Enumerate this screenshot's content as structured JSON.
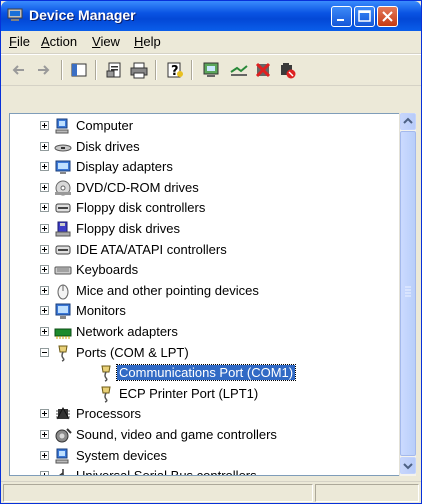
{
  "window": {
    "title": "Device Manager",
    "icon": "device-manager-icon"
  },
  "menubar": {
    "items": [
      {
        "label": "File",
        "accel": "F",
        "rest": "ile"
      },
      {
        "label": "Action",
        "accel": "A",
        "rest": "ction"
      },
      {
        "label": "View",
        "accel": "V",
        "rest": "iew"
      },
      {
        "label": "Help",
        "accel": "H",
        "rest": "elp"
      }
    ]
  },
  "toolbar": {
    "buttons": [
      "back-arrow-icon",
      "forward-arrow-icon",
      "show-hide-console-tree-icon",
      "properties-icon",
      "print-icon",
      "help-icon",
      "scan-hardware-icon",
      "update-driver-icon",
      "uninstall-icon",
      "disable-icon"
    ]
  },
  "tree": {
    "items": [
      {
        "label": "Computer",
        "icon": "computer-icon",
        "expander": "plus",
        "level": 0
      },
      {
        "label": "Disk drives",
        "icon": "disk-drive-icon",
        "expander": "plus",
        "level": 0
      },
      {
        "label": "Display adapters",
        "icon": "display-adapter-icon",
        "expander": "plus",
        "level": 0
      },
      {
        "label": "DVD/CD-ROM drives",
        "icon": "cdrom-icon",
        "expander": "plus",
        "level": 0
      },
      {
        "label": "Floppy disk controllers",
        "icon": "controller-icon",
        "expander": "plus",
        "level": 0
      },
      {
        "label": "Floppy disk drives",
        "icon": "floppy-icon",
        "expander": "plus",
        "level": 0
      },
      {
        "label": "IDE ATA/ATAPI controllers",
        "icon": "controller-icon",
        "expander": "plus",
        "level": 0
      },
      {
        "label": "Keyboards",
        "icon": "keyboard-icon",
        "expander": "plus",
        "level": 0
      },
      {
        "label": "Mice and other pointing devices",
        "icon": "mouse-icon",
        "expander": "plus",
        "level": 0
      },
      {
        "label": "Monitors",
        "icon": "monitor-icon",
        "expander": "plus",
        "level": 0
      },
      {
        "label": "Network adapters",
        "icon": "network-adapter-icon",
        "expander": "plus",
        "level": 0
      },
      {
        "label": "Ports (COM & LPT)",
        "icon": "port-icon",
        "expander": "minus",
        "level": 0
      },
      {
        "label": "Communications Port (COM1)",
        "icon": "port-icon",
        "expander": "none",
        "level": 1,
        "selected": true
      },
      {
        "label": "ECP Printer Port (LPT1)",
        "icon": "port-icon",
        "expander": "none",
        "level": 1
      },
      {
        "label": "Processors",
        "icon": "processor-icon",
        "expander": "plus",
        "level": 0
      },
      {
        "label": "Sound, video and game controllers",
        "icon": "sound-icon",
        "expander": "plus",
        "level": 0
      },
      {
        "label": "System devices",
        "icon": "system-devices-icon",
        "expander": "plus",
        "level": 0
      },
      {
        "label": "Universal Serial Bus controllers",
        "icon": "usb-icon",
        "expander": "plus",
        "level": 0
      }
    ]
  },
  "colors": {
    "titlebar": "#0a54e3",
    "selection": "#316ac5",
    "window_bg": "#ece9d8"
  }
}
